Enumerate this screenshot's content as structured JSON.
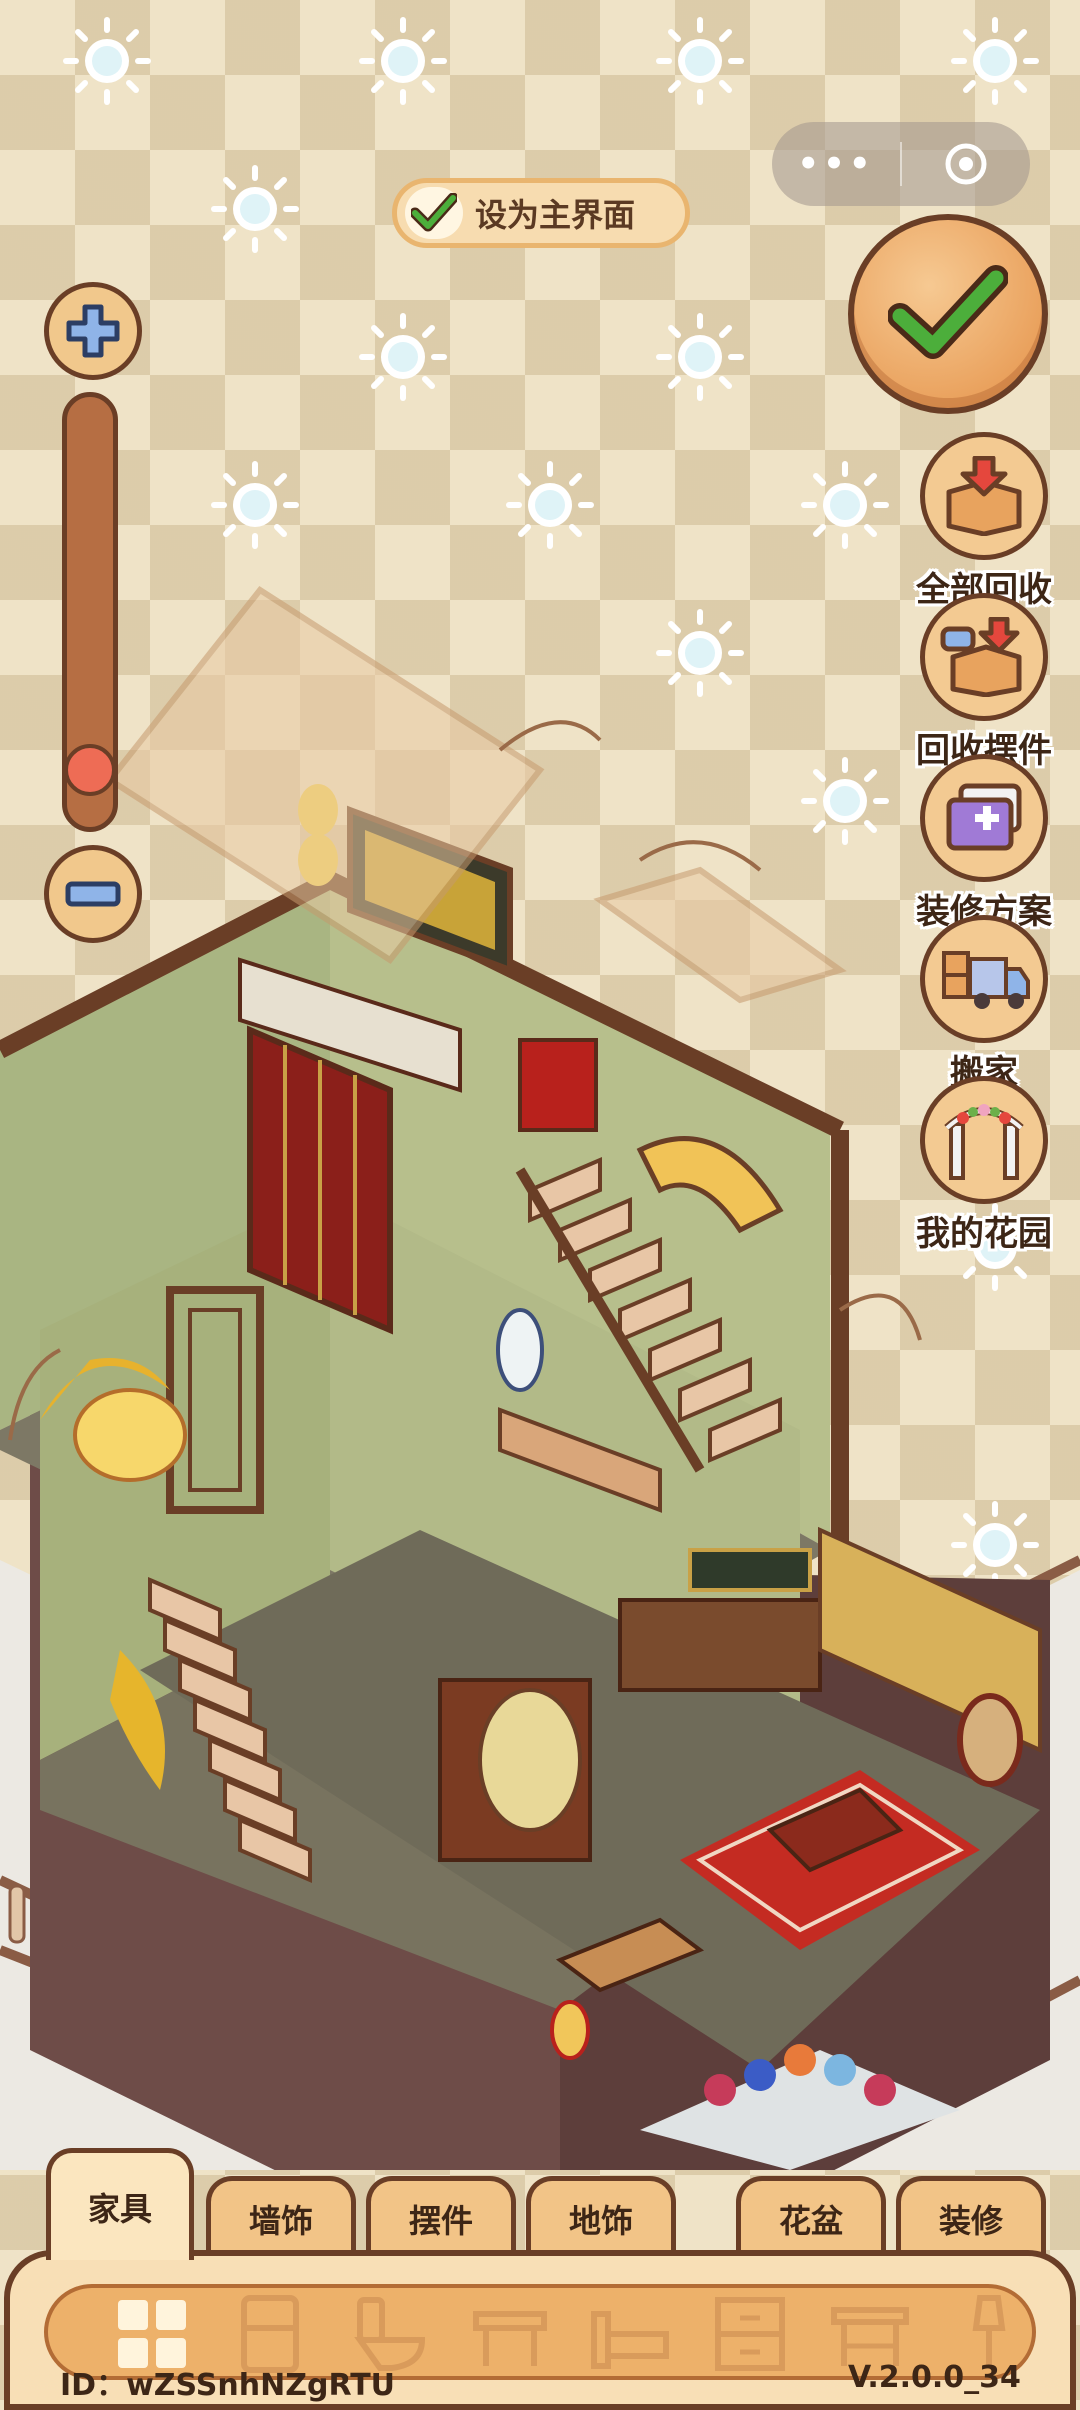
{
  "top": {
    "set_main_label": "设为主界面"
  },
  "zoom": {
    "level": 0.08
  },
  "actions": [
    {
      "label": "全部回收",
      "icon": "recycle-all-icon"
    },
    {
      "label": "回收摆件",
      "icon": "recycle-decor-icon"
    },
    {
      "label": "装修方案",
      "icon": "decor-plan-icon"
    },
    {
      "label": "搬家",
      "icon": "moving-truck-icon"
    },
    {
      "label": "我的花园",
      "icon": "garden-arch-icon"
    }
  ],
  "tabs": [
    {
      "label": "家具",
      "active": true
    },
    {
      "label": "墙饰",
      "active": false
    },
    {
      "label": "摆件",
      "active": false
    },
    {
      "label": "地饰",
      "active": false
    },
    {
      "label": "花盆",
      "active": false
    },
    {
      "label": "装修",
      "active": false
    }
  ],
  "categories": [
    "grid-icon",
    "fridge-icon",
    "toilet-icon",
    "table-icon",
    "bed-icon",
    "cabinet-icon",
    "desk-icon",
    "lamp-icon"
  ],
  "footer": {
    "id_text": "ID：wZSSnhNZgRTU",
    "version": "V.2.0.0_34"
  },
  "colors": {
    "outline": "#6a3e26",
    "button": "#f1c88c",
    "check_green": "#4cae3b",
    "slider_thumb": "#ee6c55",
    "wall_green": "#b4bc8a",
    "floor": "#7d7865"
  }
}
